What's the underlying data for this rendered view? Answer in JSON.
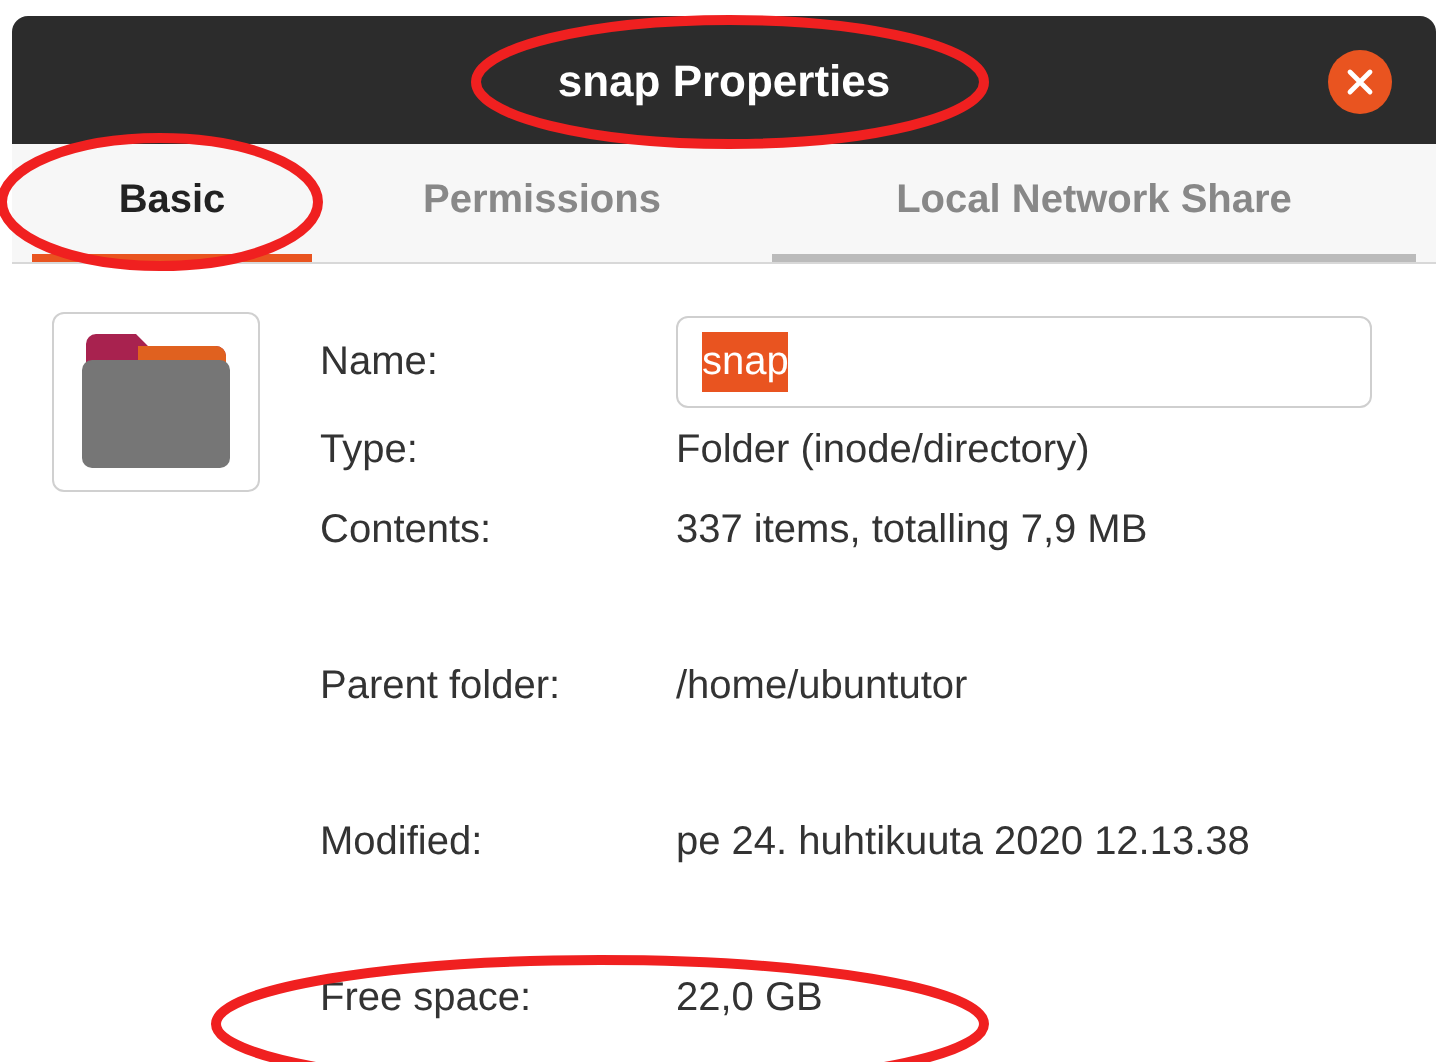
{
  "window": {
    "title": "snap Properties"
  },
  "tabs": [
    {
      "label": "Basic",
      "selected": true
    },
    {
      "label": "Permissions",
      "selected": false
    },
    {
      "label": "Local Network Share",
      "selected": false
    }
  ],
  "sections": [
    [
      {
        "kind": "field",
        "label": "Name:",
        "value": "snap",
        "value_selected": true
      },
      {
        "kind": "text",
        "label": "Type:",
        "value": "Folder (inode/directory)"
      },
      {
        "kind": "text",
        "label": "Contents:",
        "value": "337 items, totalling 7,9 MB"
      }
    ],
    [
      {
        "kind": "text",
        "label": "Parent folder:",
        "value": "/home/ubuntutor"
      }
    ],
    [
      {
        "kind": "text",
        "label": "Modified:",
        "value": "pe 24. huhtikuuta 2020 12.13.38"
      }
    ],
    [
      {
        "kind": "text",
        "label": "Free space:",
        "value": "22,0 GB"
      }
    ]
  ]
}
